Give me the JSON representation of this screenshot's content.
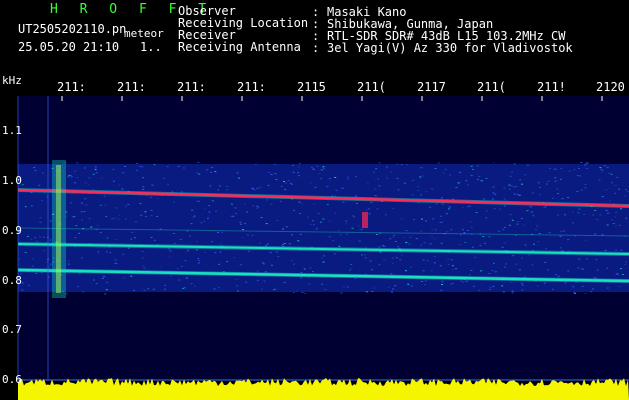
{
  "header": {
    "brand": "H R O F F T",
    "filename": "UT2505202110.pn",
    "type_label": "meteor",
    "datetime": "25.05.20 21:10",
    "index": "1..",
    "meta": [
      {
        "label": "Observer",
        "value": "Masaki Kano"
      },
      {
        "label": "Receiving Location",
        "value": "Shibukawa, Gunma, Japan"
      },
      {
        "label": "Receiver",
        "value": "RTL-SDR SDR# 43dB L15 103.2MHz CW"
      },
      {
        "label": "Receiving Antenna",
        "value": "3el Yagi(V) Az 330 for Vladivostok"
      }
    ]
  },
  "spectrogram": {
    "unit": "kHz",
    "time_labels": [
      "211:",
      "211:",
      "211:",
      "211:",
      "2115",
      "211(",
      "2117",
      "211(",
      "211!",
      "2120"
    ],
    "freq_labels": [
      "1.1",
      "1.0",
      "0.9",
      "0.8",
      "0.7",
      "0.6"
    ],
    "colors": {
      "background": "#000033",
      "noise": "#1030c0",
      "signal": "#18e0c0",
      "strong": "#ff2a55",
      "level": "#f5f500",
      "guide": "#3a6bff"
    }
  }
}
